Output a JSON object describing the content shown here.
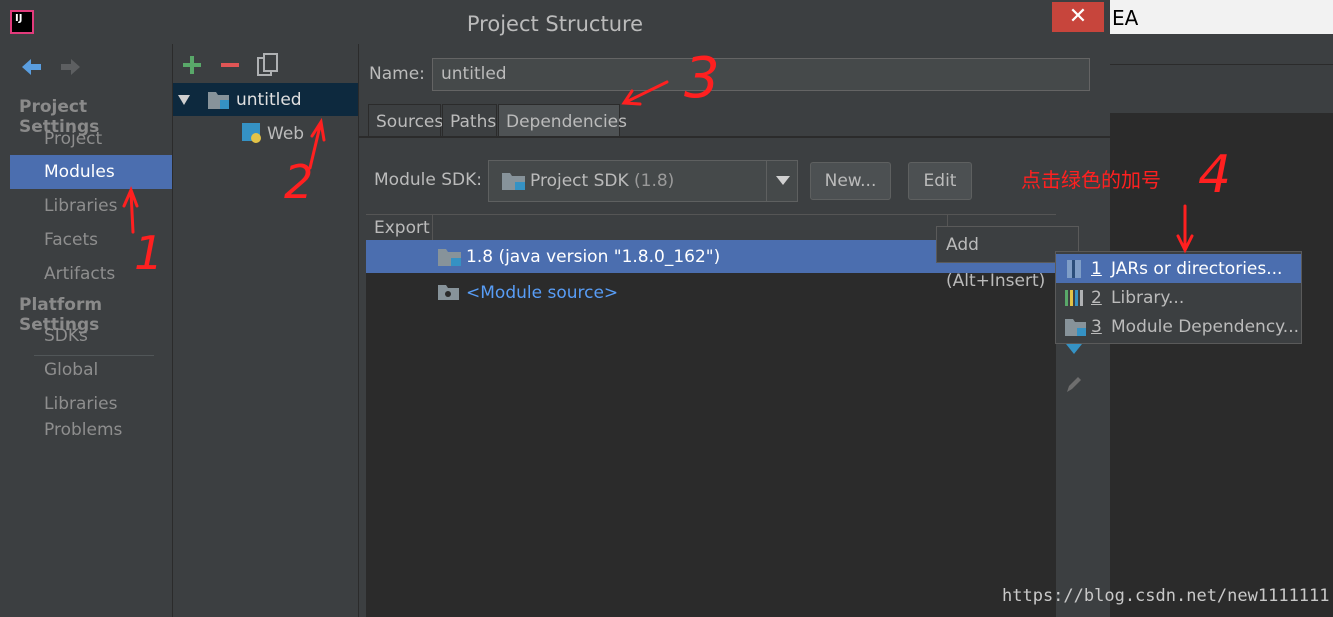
{
  "window": {
    "title": "Project Structure",
    "close_glyph": "✕",
    "app_icon_label": "IJ"
  },
  "background_app": {
    "title_fragment": "EA"
  },
  "left_nav": {
    "project_settings_header": "Project Settings",
    "project_items": [
      "Project",
      "Modules",
      "Libraries",
      "Facets",
      "Artifacts"
    ],
    "platform_settings_header": "Platform Settings",
    "platform_items": [
      "SDKs",
      "Global Libraries"
    ],
    "problems": "Problems",
    "selected": "Modules"
  },
  "tree": {
    "module": "untitled",
    "facet": "Web"
  },
  "form": {
    "name_label": "Name:",
    "name_value": "untitled",
    "tabs": [
      "Sources",
      "Paths",
      "Dependencies"
    ],
    "active_tab": "Dependencies",
    "sdk_label": "Module SDK:",
    "sdk_value": "Project SDK",
    "sdk_version": "(1.8)",
    "new_button": "New...",
    "edit_button": "Edit"
  },
  "table": {
    "header_export": "Export",
    "rows": [
      {
        "text": "1.8 (java version \"1.8.0_162\")",
        "selected": true
      },
      {
        "text": "<Module source>",
        "selected": false
      }
    ]
  },
  "tooltip": "Add (Alt+Insert)",
  "popup_menu": [
    {
      "num": "1",
      "label": "JARs or directories...",
      "selected": true
    },
    {
      "num": "2",
      "label": "Library...",
      "selected": false
    },
    {
      "num": "3",
      "label": "Module Dependency...",
      "selected": false
    }
  ],
  "annotations": {
    "n1": "1",
    "n2": "2",
    "n3": "3",
    "n4": "4",
    "hint": "点击绿色的加号"
  },
  "watermark": "https://blog.csdn.net/new1111111",
  "colors": {
    "selection": "#4b6eaf",
    "annotation": "#ff2020",
    "link": "#589df6"
  }
}
